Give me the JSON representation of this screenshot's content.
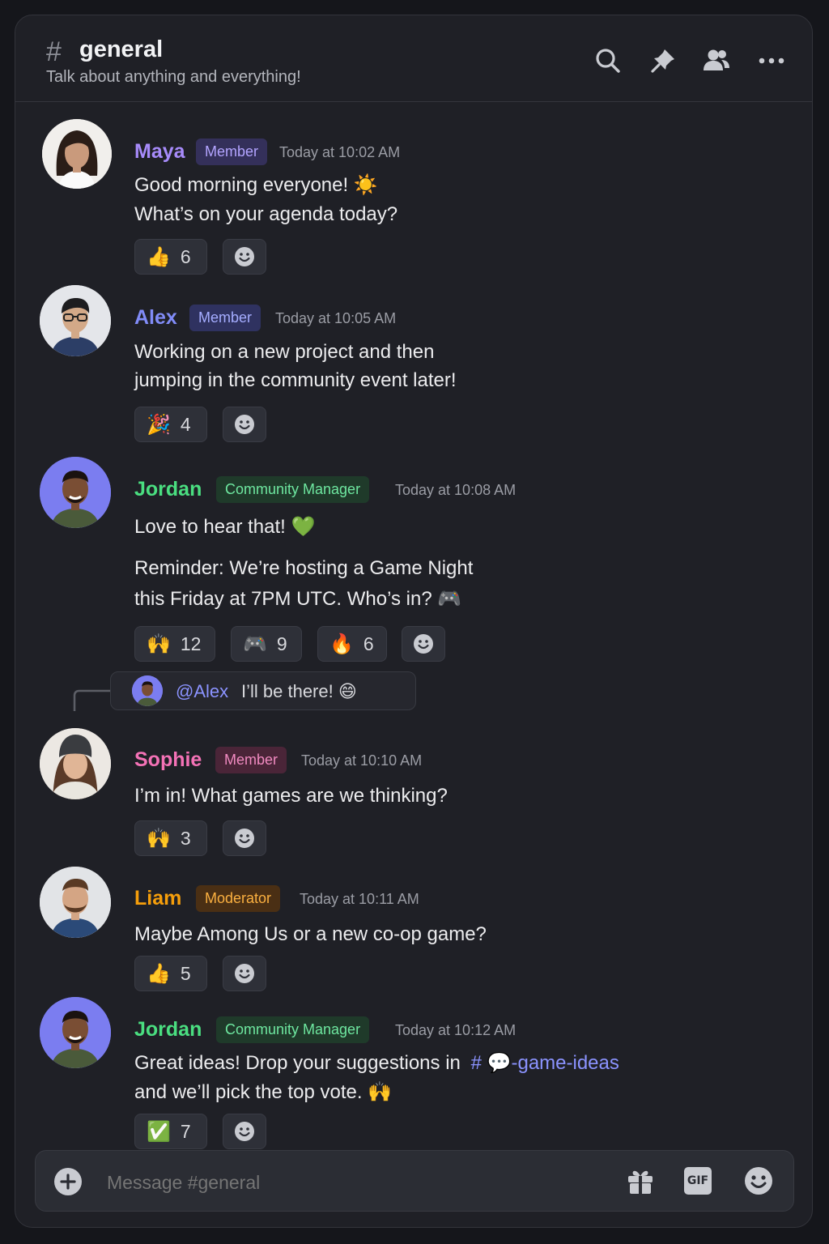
{
  "header": {
    "channel_name": "general",
    "topic": "Talk about anything and everything!",
    "icons": [
      "search-icon",
      "pin-icon",
      "members-icon",
      "more-icon"
    ]
  },
  "messages": [
    {
      "author": "Maya",
      "role": "Member",
      "time": "Today at 10:02 AM",
      "lines": [
        "Good morning everyone! ☀️",
        "What’s on your agenda today?"
      ],
      "reactions": [
        {
          "emoji": "👍",
          "count": "6"
        }
      ]
    },
    {
      "author": "Alex",
      "role": "Member",
      "time": "Today at 10:05 AM",
      "lines": [
        "Working on a new project and then",
        "jumping in the community event later!"
      ],
      "reactions": [
        {
          "emoji": "🎉",
          "count": "4"
        }
      ]
    },
    {
      "author": "Jordan",
      "role": "Community Manager",
      "time": "Today at 10:08 AM",
      "lines": [
        "Love to hear that! 💚",
        "Reminder: We’re hosting a Game Night",
        "this Friday at 7PM UTC. Who’s in? 🎮"
      ],
      "reactions": [
        {
          "emoji": "🙌",
          "count": "12"
        },
        {
          "emoji": "🎮",
          "count": "9"
        },
        {
          "emoji": "🔥",
          "count": "6"
        }
      ]
    },
    {
      "author": "Sophie",
      "role": "Member",
      "time": "Today at 10:10 AM",
      "reply": {
        "mention": "@Alex",
        "text": "I’ll be there! 😄"
      },
      "lines": [
        "I’m in! What games are we thinking?"
      ],
      "reactions": [
        {
          "emoji": "🙌",
          "count": "3"
        }
      ]
    },
    {
      "author": "Liam",
      "role": "Moderator",
      "time": "Today at 10:11 AM",
      "lines": [
        "Maybe Among Us or a new co-op game?"
      ],
      "reactions": [
        {
          "emoji": "👍",
          "count": "5"
        }
      ]
    },
    {
      "author": "Jordan",
      "role": "Community Manager",
      "time": "Today at 10:12 AM",
      "lines": [
        "Great ideas! Drop your suggestions in",
        "and we’ll pick the top vote. 🙌"
      ],
      "channel_link": {
        "hash": "#",
        "emoji": "💬",
        "name": "-game-ideas"
      },
      "reactions": [
        {
          "emoji": "✅",
          "count": "7"
        }
      ]
    }
  ],
  "composer": {
    "placeholder": "Message #general",
    "gif_label": "GIF",
    "icons": [
      "add-icon",
      "gift-icon",
      "gif-icon",
      "emoji-icon"
    ]
  },
  "colors": {
    "maya": "#a78bfa",
    "alex": "#818cf8",
    "jordan": "#4ade80",
    "sophie": "#f472b6",
    "liam": "#f59e0b",
    "link": "#8b93ff"
  }
}
